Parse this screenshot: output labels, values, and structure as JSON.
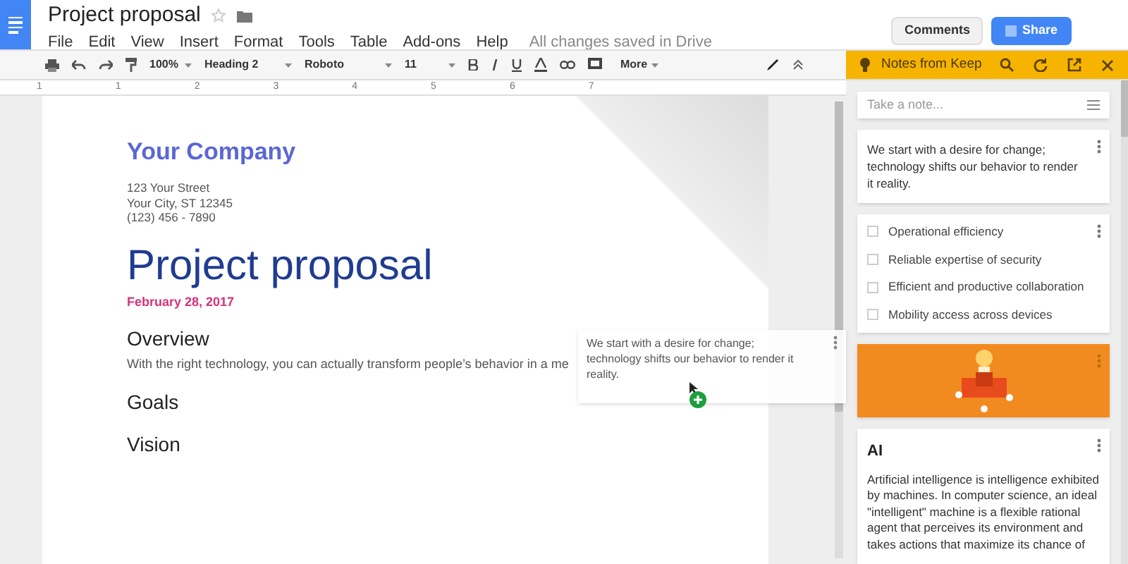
{
  "document_title": "Project proposal",
  "menu": [
    "File",
    "Edit",
    "View",
    "Insert",
    "Format",
    "Tools",
    "Table",
    "Add-ons",
    "Help"
  ],
  "save_status": "All changes saved in Drive",
  "header_buttons": [
    {
      "label": "Comments",
      "kind": "plain"
    },
    {
      "label": "Share",
      "kind": "primary"
    }
  ],
  "toolbar": {
    "zoom": "100%",
    "style": "Heading 2",
    "font": "Roboto",
    "size": "11",
    "more": "More"
  },
  "ruler": [
    "1",
    "1",
    "2",
    "3",
    "4",
    "5",
    "6",
    "7"
  ],
  "page": {
    "company": "Your Company",
    "address": [
      "123 Your Street",
      "Your City, ST 12345",
      "(123) 456 - 7890"
    ],
    "title": "Project proposal",
    "date": "February 28, 2017",
    "sections": [
      {
        "heading": "Overview",
        "body": "With the right technology, you can actually transform people’s behavior in a me"
      },
      {
        "heading": "Goals"
      },
      {
        "heading": "Vision"
      }
    ]
  },
  "dragged_note": "We start with a desire for change; technology shifts our behavior to render it reality.",
  "keep": {
    "title": "Notes from Keep",
    "placeholder": "Take a note...",
    "notes": [
      {
        "kind": "text",
        "text": "We start with a desire for change; technology shifts our behavior to render it reality."
      },
      {
        "kind": "list",
        "items": [
          {
            "label": "Operational efficiency",
            "checked": false
          },
          {
            "label": "Reliable expertise of security",
            "checked": false
          },
          {
            "label": "Efficient and productive collaboration",
            "checked": false
          },
          {
            "label": "Mobility access across devices",
            "checked": false
          }
        ]
      },
      {
        "kind": "image"
      },
      {
        "kind": "titled",
        "title": "AI",
        "text": "Artificial intelligence is intelligence exhibited by machines. In computer science, an ideal \"intelligent\" machine is a flexible rational agent that perceives its environment and takes actions that maximize its chance of"
      }
    ]
  }
}
